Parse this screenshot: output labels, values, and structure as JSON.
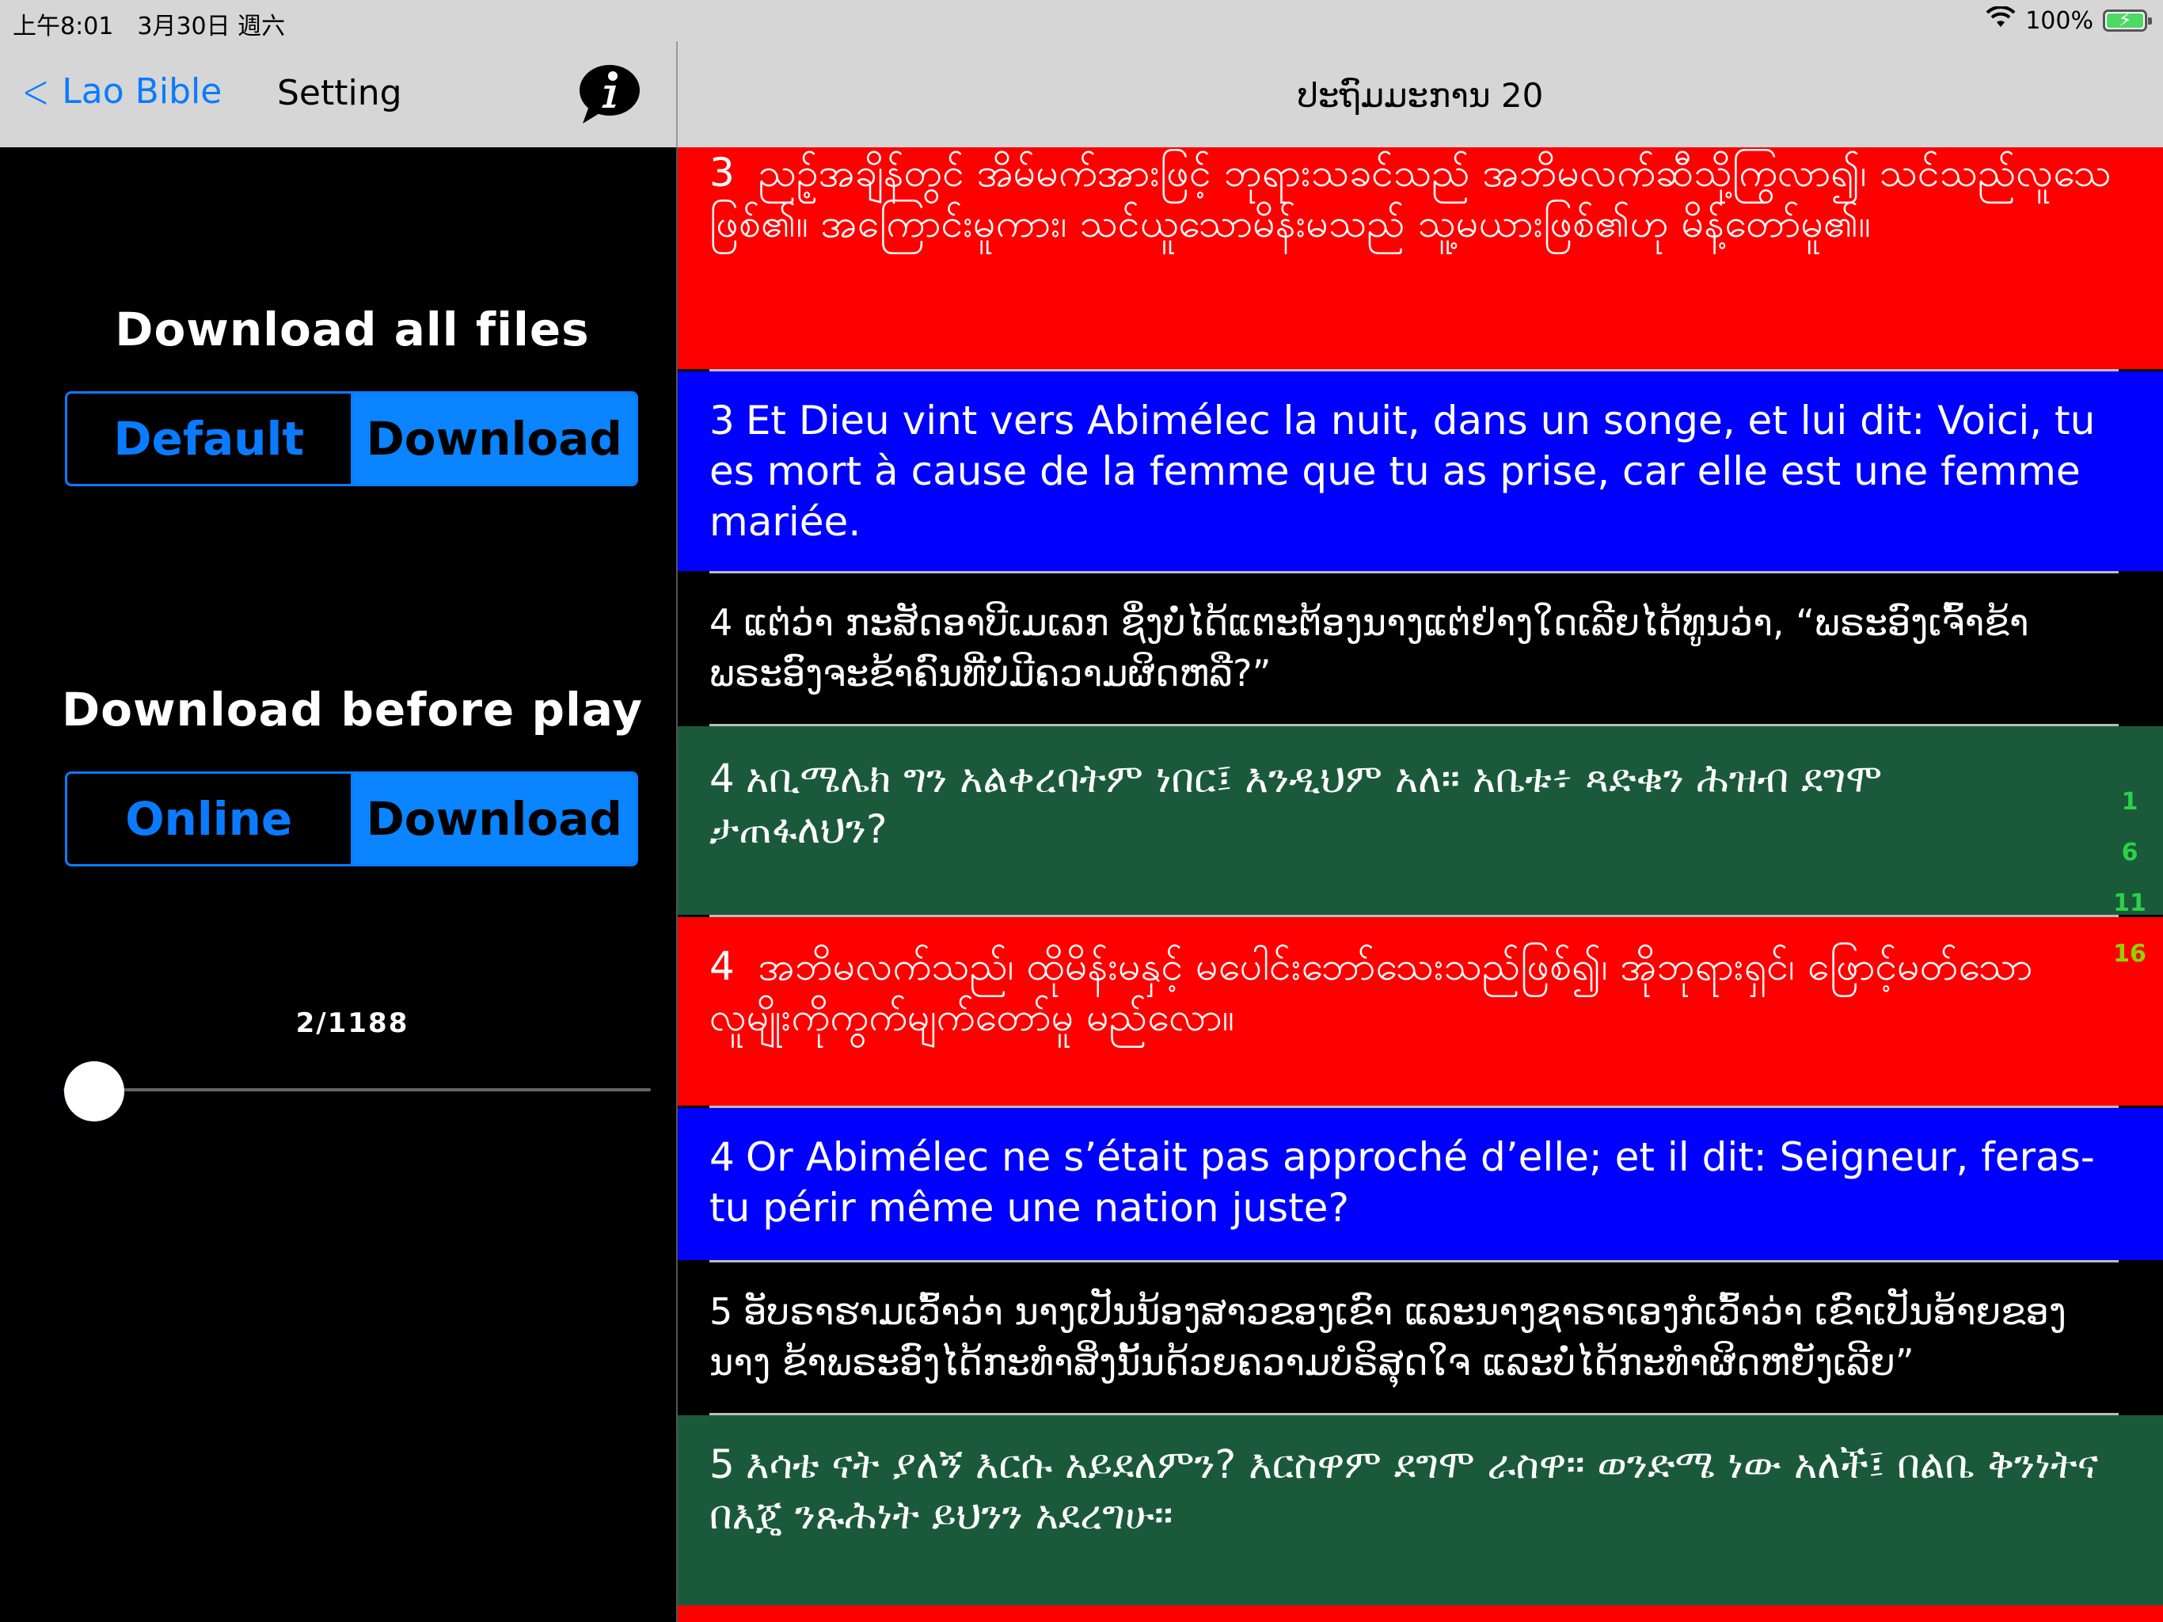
{
  "status_bar": {
    "time": "上午8:01　3月30日 週六",
    "battery": "100%"
  },
  "nav_left": {
    "back_label": "Lao Bible",
    "title": "Setting"
  },
  "nav_right": {
    "title": "ປະຖົມມະການ 20"
  },
  "settings": {
    "download_all": {
      "title": "Download all files",
      "options": [
        "Default",
        "Download"
      ],
      "selected": "Download"
    },
    "download_before_play": {
      "title": "Download before play",
      "options": [
        "Online",
        "Download"
      ],
      "selected": "Download"
    },
    "progress": {
      "label": "2/1188",
      "current": 2,
      "total": 1188
    }
  },
  "verses": [
    {
      "num": "3",
      "text": " ညဥ့်အချိန်တွင် အိမ်မက်အားဖြင့် ဘုရားသခင်သည် အဘိမလက်ဆီသို့ကြွလာ၍၊ သင်သည်လူသေဖြစ်၏။ အကြောင်းမူကား၊ သင်ယူသောမိန်းမသည် သူ့မယားဖြစ်၏ဟု မိန့်တော်မူ၏။",
      "bg": "#ff0000"
    },
    {
      "num": "3",
      "text": "Et Dieu vint vers Abimélec la nuit, dans un songe, et lui dit: Voici, tu es mort à cause de la femme que tu as prise, car elle est une femme mariée.",
      "bg": "#0000ff"
    },
    {
      "num": "4",
      "text": "ແຕ່ວ່າ ກະສັດອາບີເມເລກ ຊຶ່ງບໍ່ໄດ້ແຕະຕ້ອງນາງແຕ່ຢ່າງໃດເລີຍໄດ້ທູນວ່າ, “ພຣະອົງເຈົ້າຂ້າ ພຣະອົງຈະຂ້າຄົນທີ່ບໍ່ມີຄວາມຜິດຫລື?”",
      "bg": "#000000"
    },
    {
      "num": "4",
      "text": "አቢሜሌክ ግን አልቀረባትም ነበር፤ እንዲህም አለ።   አቤቱ፥ ጻድቁን ሕዝብ ደግሞ ታጠፋለህን?",
      "bg": "#1a5a3a"
    },
    {
      "num": "4",
      "text": " အဘိမလက်သည်၊ ထိုမိန်းမနှင့် မပေါင်းဘော်သေးသည်ဖြစ်၍၊ အိုဘုရားရှင်၊ ဖြောင့်မတ်သော လူမျိုးကိုကွက်မျက်တော်မူ မည်လော။",
      "bg": "#ff0000"
    },
    {
      "num": "4",
      "text": "Or Abimélec ne s’était pas approché d’elle; et il dit: Seigneur, feras-tu périr même une nation juste?",
      "bg": "#0000ff"
    },
    {
      "num": "5",
      "text": "ອັບຣາຮາມເວົ້າວ່າ ນາງເປັນນ້ອງສາວຂອງເຂົາ ແລະນາງຊາຣາເອງກໍເວົ້າວ່າ ເຂົາເປັນອ້າຍຂອງນາງ ຂ້າພຣະອົງໄດ້ກະທຳສິ່ງນັ້ນດ້ວຍຄວາມບໍຣິສຸດໃຈ ແລະບໍ່ໄດ້ກະທຳຜິດຫຍັງເລີຍ”",
      "bg": "#000000"
    },
    {
      "num": "5",
      "text": "እሳቴ ናት ያለኝ እርሱ አይደለምን? እርስዋም ደግሞ  ራስዋ። ወንድሜ ነው አለች፤ በልቤ ቅንነትና በእጄ ንጹሕነት  ይህንን አደረግሁ።",
      "bg": "#1a5a3a"
    },
    {
      "num": "",
      "text": "",
      "bg": "#ff0000"
    }
  ],
  "index_strip": [
    "1",
    "6",
    "11",
    "16"
  ],
  "colors": {
    "accent": "#0a84ff",
    "verse_red": "#ff0000",
    "verse_blue": "#0000ff",
    "verse_green": "#1a5a3a",
    "index_green": "#2bd14a",
    "index_highlight": "#8fd400"
  }
}
